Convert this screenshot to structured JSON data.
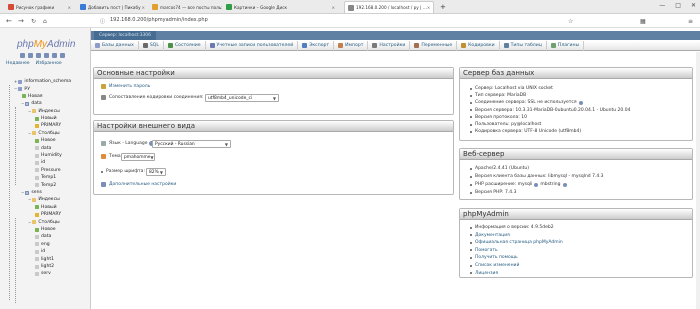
{
  "browser": {
    "tabs": [
      {
        "label": "Рисунок графики",
        "active": false
      },
      {
        "label": "Добавить пост | Пикабу",
        "active": false
      },
      {
        "label": "marcos74 — все посты пользо...",
        "active": false
      },
      {
        "label": "Картинки – Google Диск",
        "active": false
      },
      {
        "label": "192.168.0.200 / localhost / py | ...",
        "active": true
      }
    ],
    "new_tab": "+",
    "url": "192.168.0.200/phpmyadmin/index.php"
  },
  "sidebar": {
    "logo": {
      "php": "php",
      "my": "My",
      "admin": "Admin"
    },
    "links": [
      "Недавнее",
      "Избранное"
    ],
    "tree": [
      {
        "label": "information_schema",
        "icon": "database-icon",
        "depth": 0
      },
      {
        "label": "py",
        "icon": "database-icon",
        "depth": 0
      },
      {
        "label": "Новая",
        "icon": "new-icon",
        "depth": 1
      },
      {
        "label": "data",
        "icon": "table-icon",
        "depth": 1
      },
      {
        "label": "Индексы",
        "icon": "folder-icon",
        "depth": 2
      },
      {
        "label": "Новый",
        "icon": "new-icon",
        "depth": 3
      },
      {
        "label": "PRIMARY",
        "icon": "key-icon",
        "depth": 3
      },
      {
        "label": "Столбцы",
        "icon": "folder-icon",
        "depth": 2
      },
      {
        "label": "Новое",
        "icon": "new-icon",
        "depth": 3
      },
      {
        "label": "data",
        "icon": "column-icon",
        "depth": 3
      },
      {
        "label": "Humidity",
        "icon": "column-icon",
        "depth": 3
      },
      {
        "label": "id",
        "icon": "column-icon",
        "depth": 3
      },
      {
        "label": "Pressure",
        "icon": "column-icon",
        "depth": 3
      },
      {
        "label": "Temp1",
        "icon": "column-icon",
        "depth": 3
      },
      {
        "label": "Temp2",
        "icon": "column-icon",
        "depth": 3
      },
      {
        "label": "sens",
        "icon": "table-icon",
        "depth": 1
      },
      {
        "label": "Индексы",
        "icon": "folder-icon",
        "depth": 2
      },
      {
        "label": "Новый",
        "icon": "new-icon",
        "depth": 3
      },
      {
        "label": "PRIMARY",
        "icon": "key-icon",
        "depth": 3
      },
      {
        "label": "Столбцы",
        "icon": "folder-icon",
        "depth": 2
      },
      {
        "label": "Новое",
        "icon": "new-icon",
        "depth": 3
      },
      {
        "label": "data",
        "icon": "column-icon",
        "depth": 3
      },
      {
        "label": "eng",
        "icon": "column-icon",
        "depth": 3
      },
      {
        "label": "id",
        "icon": "column-icon",
        "depth": 3
      },
      {
        "label": "light1",
        "icon": "column-icon",
        "depth": 3
      },
      {
        "label": "light2",
        "icon": "column-icon",
        "depth": 3
      },
      {
        "label": "serv",
        "icon": "column-icon",
        "depth": 3
      }
    ]
  },
  "breadcrumb": {
    "server": "Сервер: localhost:3306"
  },
  "nav_tabs": [
    {
      "label": "Базы данных",
      "icon": "database-icon"
    },
    {
      "label": "SQL",
      "icon": "sql-icon"
    },
    {
      "label": "Состояние",
      "icon": "status-icon"
    },
    {
      "label": "Учетные записи пользователей",
      "icon": "users-icon"
    },
    {
      "label": "Экспорт",
      "icon": "export-icon"
    },
    {
      "label": "Импорт",
      "icon": "import-icon"
    },
    {
      "label": "Настройки",
      "icon": "settings-icon"
    },
    {
      "label": "Переменные",
      "icon": "variables-icon"
    },
    {
      "label": "Кодировки",
      "icon": "charset-icon"
    },
    {
      "label": "Типы таблиц",
      "icon": "engines-icon"
    },
    {
      "label": "Плагины",
      "icon": "plugins-icon"
    }
  ],
  "general_settings": {
    "title": "Основные настройки",
    "change_password": "Изменить пароль",
    "collation_label": "Сопоставление кодировки соединения:",
    "collation_value": "utf8mb4_unicode_ci"
  },
  "appearance": {
    "title": "Настройки внешнего вида",
    "language_label": "Язык - Language",
    "language_value": "Русский - Russian",
    "theme_label": "Тема:",
    "theme_value": "pmahomme",
    "font_label": "Размер шрифта:",
    "font_value": "82%",
    "more_settings": "Дополнительные настройки"
  },
  "db_server": {
    "title": "Сервер баз данных",
    "items": [
      "Сервер: Localhost via UNIX socket",
      "Тип сервера: MariaDB",
      "Соединение сервера: SSL не используется",
      "Версия сервера: 10.3.31-MariaDB-0ubuntu0.20.04.1 - Ubuntu 20.04",
      "Версия протокола: 10",
      "Пользователь: py@localhost",
      "Кодировка сервера: UTF-8 Unicode (utf8mb4)"
    ]
  },
  "web_server": {
    "title": "Веб-сервер",
    "items": [
      "Apache/2.4.41 (Ubuntu)",
      "Версия клиента базы данных: libmysql - mysqlnd 7.4.3",
      "PHP расширение: mysqli",
      "Версия PHP: 7.4.3"
    ],
    "ext_extra": "mbstring"
  },
  "pma": {
    "title": "phpMyAdmin",
    "items": [
      {
        "label": "Информация о версии: 4.9.5deb2",
        "link": false
      },
      {
        "label": "Документация",
        "link": true
      },
      {
        "label": "Официальная страница phpMyAdmin",
        "link": true
      },
      {
        "label": "Помогать",
        "link": true
      },
      {
        "label": "Получить помощь",
        "link": true
      },
      {
        "label": "Список изменений",
        "link": true
      },
      {
        "label": "Лицензия",
        "link": true
      }
    ]
  },
  "colors": {
    "link": "#235a81",
    "breadcrumb": "#5f7fa3",
    "logo_php": "#6c78af",
    "logo_my": "#f29111"
  }
}
